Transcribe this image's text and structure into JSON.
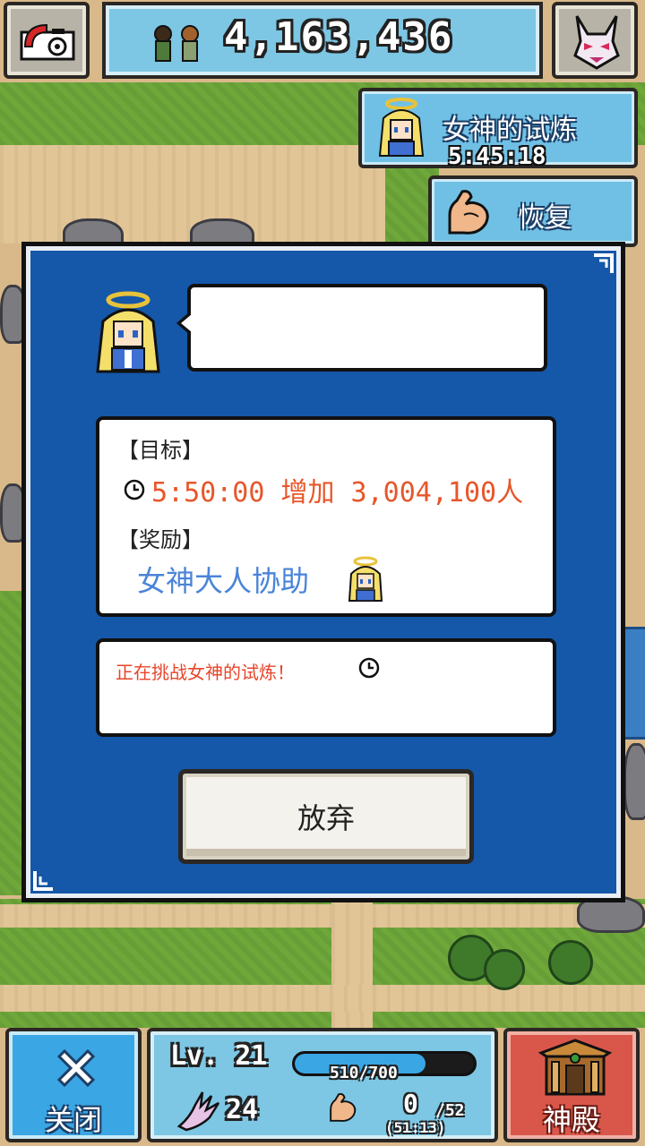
{
  "top_bar": {
    "population": "4,163,436"
  },
  "trial": {
    "title": "女神的试炼",
    "timer": "5:45:18"
  },
  "recover": {
    "label": "恢复"
  },
  "dialog": {
    "speech_text": "",
    "goal_label": "【目标】",
    "goal_text": "5:50:00 增加 3,004,100人",
    "reward_label": "【奖励】",
    "reward_text": "女神大人协助",
    "status_text": "正在挑战女神的试炼！",
    "abandon_label": "放弃"
  },
  "bottom_bar": {
    "close_label": "关闭",
    "level": "Lv. 21",
    "exp_text": "510/700",
    "exp_fraction": 0.73,
    "attack": "24",
    "stamina": "0",
    "stamina_max": "/52",
    "stamina_timer": "(51:13)",
    "shrine_label": "神殿"
  },
  "colors": {
    "dialog_bg": "#1557a8",
    "goal_text": "#e8562a",
    "reward_text": "#4a84d8",
    "status_text": "#e8452a",
    "panel_blue": "#7dc6e4",
    "shrine_red": "#d9574a"
  },
  "icons": {
    "camera": "camera-icon",
    "monster": "monster-icon",
    "people": "people-icon",
    "goddess": "goddess-icon",
    "arm": "arm-icon",
    "clock": "clock-icon",
    "close": "close-icon",
    "claw": "claw-icon",
    "shrine": "shrine-icon"
  }
}
